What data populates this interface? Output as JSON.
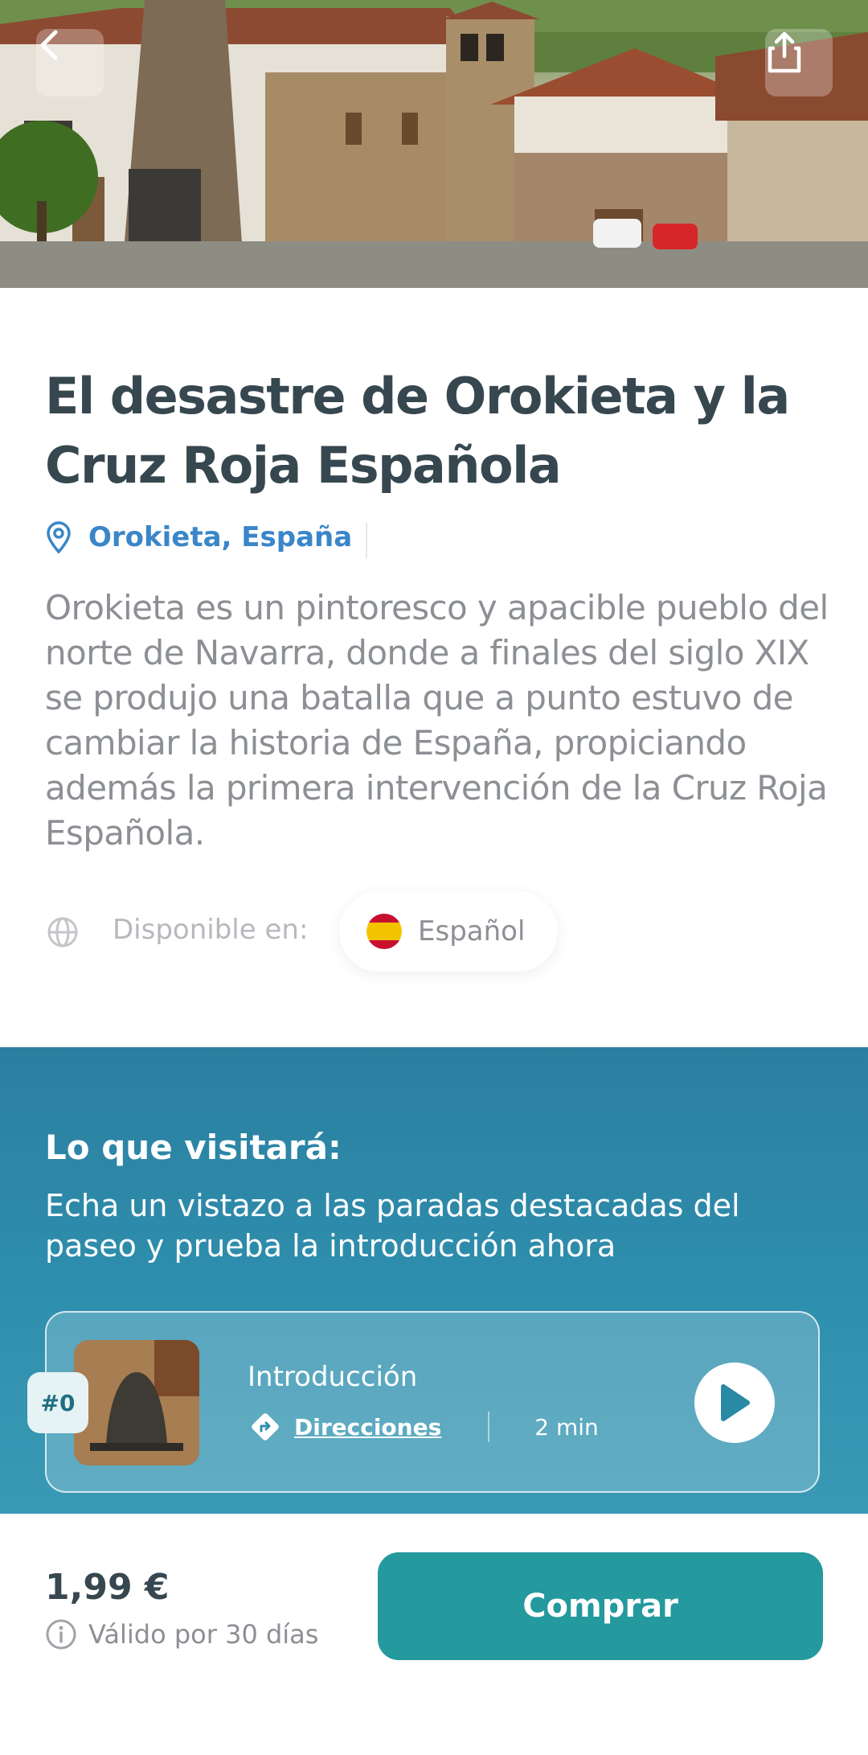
{
  "hero": {
    "alt": "Orokieta village"
  },
  "tour": {
    "title": "El desastre de Orokieta y la Cruz Roja Española",
    "location": "Orokieta, España",
    "description": "Orokieta es un pintoresco y apacible pueblo del norte de Navarra, donde a finales del siglo XIX se produjo una batalla que a punto estuvo de cambiar la historia de España, propiciando además la primera intervención de la Cruz Roja Española.",
    "available_label": "Disponible en:",
    "language": "Español"
  },
  "stops": {
    "title": "Lo que visitará:",
    "subtitle": "Echa un vistazo a las paradas destacadas del paseo y prueba la introducción ahora",
    "items": [
      {
        "badge": "#0",
        "name": "Introducción",
        "directions": "Direcciones",
        "duration": "2 min"
      }
    ]
  },
  "purchase": {
    "price": "1,99 €",
    "validity": "Válido por 30 días",
    "buy_label": "Comprar"
  },
  "colors": {
    "primary": "#24999e",
    "section": "#2b7fa0",
    "link": "#3a86c8",
    "title": "#37474f"
  },
  "icons": [
    "back-icon",
    "share-icon",
    "location-pin-icon",
    "globe-icon",
    "spain-flag-icon",
    "directions-icon",
    "play-icon",
    "info-icon"
  ]
}
